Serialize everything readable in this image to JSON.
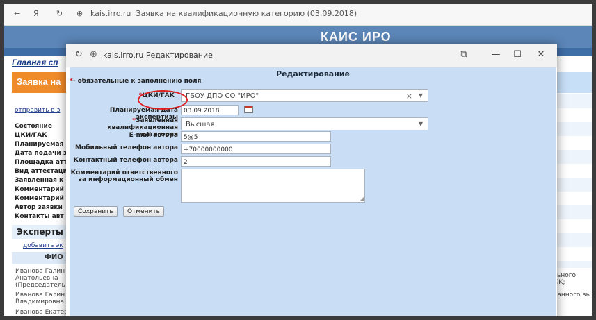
{
  "bg_browser": {
    "back": "←",
    "forward": "Я",
    "reload": "↻",
    "url": "kais.irro.ru",
    "page_title": "Заявка на квалификационную категорию (03.09.2018)"
  },
  "bg_site": {
    "brand": "КАИС ИРО",
    "main_link": "Главная сп",
    "app_title": "Заявка на",
    "send_link": "отправить в з",
    "fields": [
      "Состояние",
      "ЦКИ/ГАК",
      "Планируемая",
      "Дата подачи з",
      "Площадка атт",
      "Вид аттестаци",
      "Заявленная к",
      "Комментарий",
      "Комментарий",
      "Автор заявки",
      "Контакты авт"
    ],
    "experts_title": "Эксперты",
    "add_expert_link": "добавить эк",
    "fio_header": "ФИО",
    "persons": [
      [
        "Иванова Галин",
        "Анатольевна",
        "(Председатель"
      ],
      [
        "Иванова Галин",
        "Владимировна"
      ],
      [
        "Иванова Екатер"
      ]
    ],
    "right_texts": [
      [
        "ательного",
        "й, ВКК;"
      ],
      [
        "ированного вы"
      ]
    ]
  },
  "modal": {
    "url": "kais.irro.ru",
    "title": "Редактирование",
    "form_title": "Редактирование",
    "required_note": "- обязательные к заполнению поля",
    "star": "*",
    "fields": {
      "cki_label": "ЦКИ/ГАК",
      "cki_value": "ГБОУ ДПО СО \"ИРО\"",
      "date_label": "Планируемая дата экспертизы",
      "date_value": "03.09.2018",
      "category_label_1": "Заявленная",
      "category_label_2": "квалификационная категория",
      "category_value": "Высшая",
      "email_label": "E-mail автора",
      "email_value": "5@5",
      "mobile_label": "Мобильный телефон автора",
      "mobile_value": "+70000000000",
      "contact_label": "Контактный телефон автора",
      "contact_value": "2",
      "comment_label_1": "Комментарий ответственного",
      "comment_label_2": "за информационный обмен",
      "comment_value": ""
    },
    "buttons": {
      "save": "Сохранить",
      "cancel": "Отменить"
    },
    "window_controls": {
      "restore": "⧉",
      "minimize": "—",
      "maximize": "☐",
      "close": "✕"
    },
    "select_icons": {
      "clear": "×",
      "caret": "▼"
    }
  },
  "colors": {
    "header": "#5c86b8",
    "orange": "#f08b2a",
    "form_bg": "#c9def4",
    "annotation": "#e02020"
  }
}
